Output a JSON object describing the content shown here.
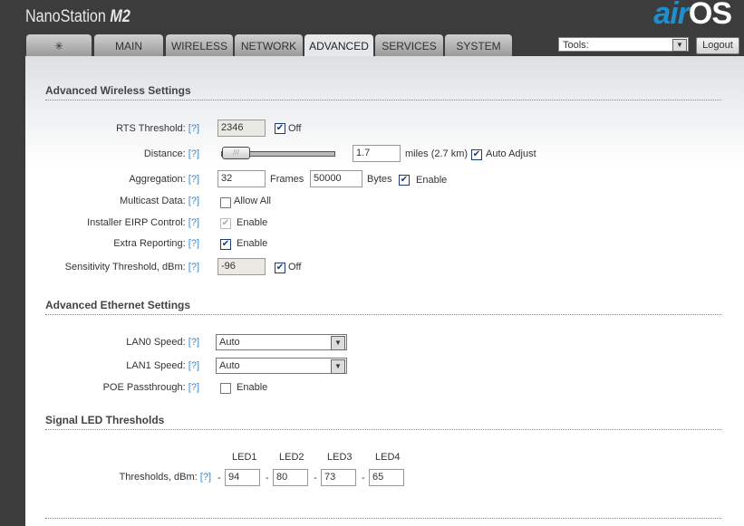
{
  "header": {
    "brand": "NanoStation",
    "brand_model": "M2",
    "logo_air": "air",
    "logo_os": "OS",
    "tools_label": "Tools:",
    "logout": "Logout"
  },
  "tabs": [
    "MAIN",
    "WIRELESS",
    "NETWORK",
    "ADVANCED",
    "SERVICES",
    "SYSTEM"
  ],
  "active_tab": "ADVANCED",
  "help": "[?]",
  "wireless": {
    "title": "Advanced Wireless Settings",
    "rts_label": "RTS Threshold:",
    "rts_value": "2346",
    "rts_off": "Off",
    "distance_label": "Distance:",
    "distance_value": "1.7",
    "distance_unit": "miles (2.7 km)",
    "auto_adjust": "Auto Adjust",
    "aggregation_label": "Aggregation:",
    "agg_frames": "32",
    "frames": "Frames",
    "agg_bytes": "50000",
    "bytes": "Bytes",
    "agg_enable": "Enable",
    "multicast_label": "Multicast Data:",
    "allow_all": "Allow All",
    "eirp_label": "Installer EIRP Control:",
    "eirp_enable": "Enable",
    "extra_label": "Extra Reporting:",
    "extra_enable": "Enable",
    "sens_label": "Sensitivity Threshold, dBm:",
    "sens_value": "-96",
    "sens_off": "Off"
  },
  "ethernet": {
    "title": "Advanced Ethernet Settings",
    "lan0_label": "LAN0 Speed:",
    "lan0_value": "Auto",
    "lan1_label": "LAN1 Speed:",
    "lan1_value": "Auto",
    "poe_label": "POE Passthrough:",
    "poe_enable": "Enable"
  },
  "led": {
    "title": "Signal LED Thresholds",
    "headers": [
      "LED1",
      "LED2",
      "LED3",
      "LED4"
    ],
    "label": "Thresholds, dBm:",
    "values": [
      "94",
      "80",
      "73",
      "65"
    ],
    "sep": "-"
  }
}
